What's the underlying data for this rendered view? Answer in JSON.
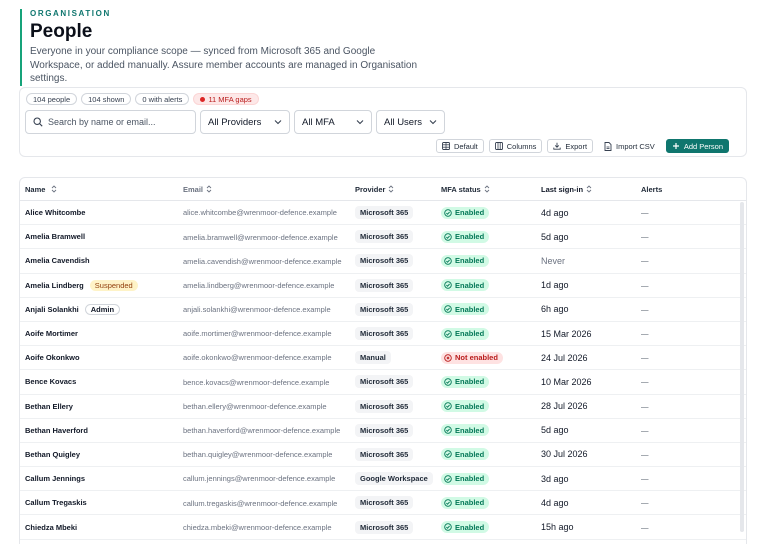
{
  "header": {
    "eyebrow": "ORGANISATION",
    "title": "People",
    "description": "Everyone in your compliance scope — synced from Microsoft 365 and Google Workspace, or added manually. Assure member accounts are managed in Organisation settings."
  },
  "chips": {
    "people": "104 people",
    "shown": "104 shown",
    "alerts": "0 with alerts",
    "mfa_gaps": "11 MFA gaps"
  },
  "filters": {
    "search_placeholder": "Search by name or email...",
    "provider": "All Providers",
    "mfa": "All MFA",
    "users": "All Users"
  },
  "toolbar": {
    "default": "Default",
    "columns": "Columns",
    "export": "Export",
    "import": "Import CSV",
    "add": "Add Person"
  },
  "columns": {
    "name": "Name",
    "email": "Email",
    "provider": "Provider",
    "mfa": "MFA status",
    "last_signin": "Last sign-in",
    "alerts": "Alerts"
  },
  "colors": {
    "accent": "#0f766e",
    "mfa_enabled": "#047857",
    "mfa_not_enabled": "#b91c1c",
    "suspended": "#92400e"
  },
  "rows": [
    {
      "name": "Alice Whitcombe",
      "badge": "",
      "email": "alice.whitcombe@wrenmoor-defence.example",
      "provider": "Microsoft 365",
      "mfa": "Enabled",
      "mfa_ok": true,
      "last": "4d ago",
      "alerts": "—"
    },
    {
      "name": "Amelia Bramwell",
      "badge": "",
      "email": "amelia.bramwell@wrenmoor-defence.example",
      "provider": "Microsoft 365",
      "mfa": "Enabled",
      "mfa_ok": true,
      "last": "5d ago",
      "alerts": "—"
    },
    {
      "name": "Amelia Cavendish",
      "badge": "",
      "email": "amelia.cavendish@wrenmoor-defence.example",
      "provider": "Microsoft 365",
      "mfa": "Enabled",
      "mfa_ok": true,
      "last": "Never",
      "alerts": "—"
    },
    {
      "name": "Amelia Lindberg",
      "badge": "Suspended",
      "email": "amelia.lindberg@wrenmoor-defence.example",
      "provider": "Microsoft 365",
      "mfa": "Enabled",
      "mfa_ok": true,
      "last": "1d ago",
      "alerts": "—"
    },
    {
      "name": "Anjali Solankhi",
      "badge": "Admin",
      "email": "anjali.solankhi@wrenmoor-defence.example",
      "provider": "Microsoft 365",
      "mfa": "Enabled",
      "mfa_ok": true,
      "last": "6h ago",
      "alerts": "—"
    },
    {
      "name": "Aoife Mortimer",
      "badge": "",
      "email": "aoife.mortimer@wrenmoor-defence.example",
      "provider": "Microsoft 365",
      "mfa": "Enabled",
      "mfa_ok": true,
      "last": "15 Mar 2026",
      "alerts": "—"
    },
    {
      "name": "Aoife Okonkwo",
      "badge": "",
      "email": "aoife.okonkwo@wrenmoor-defence.example",
      "provider": "Manual",
      "mfa": "Not enabled",
      "mfa_ok": false,
      "last": "24 Jul 2026",
      "alerts": "—"
    },
    {
      "name": "Bence Kovacs",
      "badge": "",
      "email": "bence.kovacs@wrenmoor-defence.example",
      "provider": "Microsoft 365",
      "mfa": "Enabled",
      "mfa_ok": true,
      "last": "10 Mar 2026",
      "alerts": "—"
    },
    {
      "name": "Bethan Ellery",
      "badge": "",
      "email": "bethan.ellery@wrenmoor-defence.example",
      "provider": "Microsoft 365",
      "mfa": "Enabled",
      "mfa_ok": true,
      "last": "28 Jul 2026",
      "alerts": "—"
    },
    {
      "name": "Bethan Haverford",
      "badge": "",
      "email": "bethan.haverford@wrenmoor-defence.example",
      "provider": "Microsoft 365",
      "mfa": "Enabled",
      "mfa_ok": true,
      "last": "5d ago",
      "alerts": "—"
    },
    {
      "name": "Bethan Quigley",
      "badge": "",
      "email": "bethan.quigley@wrenmoor-defence.example",
      "provider": "Microsoft 365",
      "mfa": "Enabled",
      "mfa_ok": true,
      "last": "30 Jul 2026",
      "alerts": "—"
    },
    {
      "name": "Callum Jennings",
      "badge": "",
      "email": "callum.jennings@wrenmoor-defence.example",
      "provider": "Google Workspace",
      "mfa": "Enabled",
      "mfa_ok": true,
      "last": "3d ago",
      "alerts": "—"
    },
    {
      "name": "Callum Tregaskis",
      "badge": "",
      "email": "callum.tregaskis@wrenmoor-defence.example",
      "provider": "Microsoft 365",
      "mfa": "Enabled",
      "mfa_ok": true,
      "last": "4d ago",
      "alerts": "—"
    },
    {
      "name": "Chiedza Mbeki",
      "badge": "",
      "email": "chiedza.mbeki@wrenmoor-defence.example",
      "provider": "Microsoft 365",
      "mfa": "Enabled",
      "mfa_ok": true,
      "last": "15h ago",
      "alerts": "—"
    }
  ]
}
